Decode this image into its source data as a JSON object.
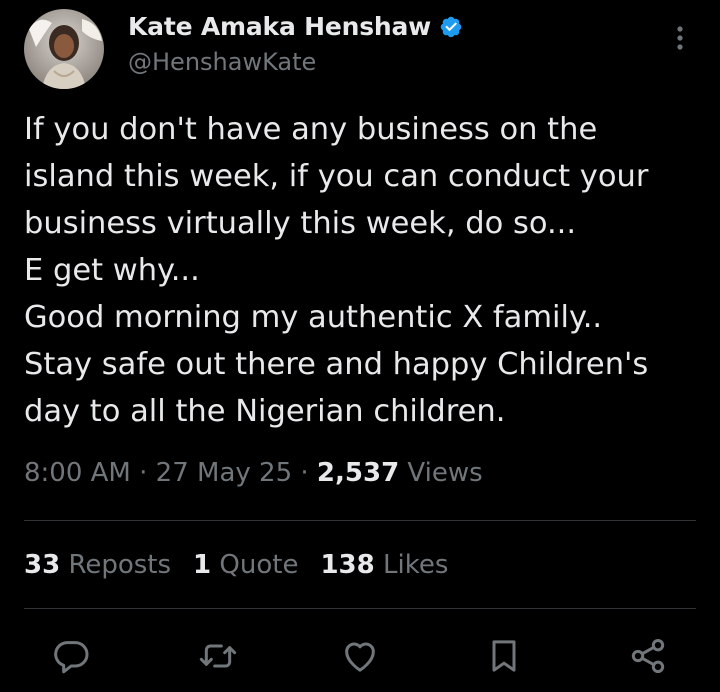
{
  "author": {
    "name": "Kate Amaka Henshaw",
    "handle": "@HenshawKate",
    "verified": true
  },
  "tweet": {
    "lines": [
      "If you don't have any business on the",
      "island this week, if you can conduct your",
      "business virtually this week, do so...",
      "E get why...",
      "Good morning my authentic X family..",
      "Stay safe out there and happy Children's",
      "day to all the Nigerian children."
    ]
  },
  "meta": {
    "time": "8:00 AM",
    "sep1": " · ",
    "date": "27 May 25",
    "sep2": " · ",
    "views_count": "2,537",
    "views_label": " Views"
  },
  "stats": {
    "reposts_count": "33",
    "reposts_label": " Reposts",
    "quotes_count": "1",
    "quotes_label": " Quote",
    "likes_count": "138",
    "likes_label": " Likes"
  },
  "icons": {
    "reply": "reply-icon",
    "repost": "repost-icon",
    "like": "heart-icon",
    "bookmark": "bookmark-icon",
    "share": "share-icon",
    "more": "more-vertical-icon",
    "verified": "verified-badge-icon"
  },
  "colors": {
    "background": "#000000",
    "text": "#e7e9ea",
    "secondary": "#71767b",
    "verified": "#1d9bf0",
    "divider": "#2f3336"
  }
}
